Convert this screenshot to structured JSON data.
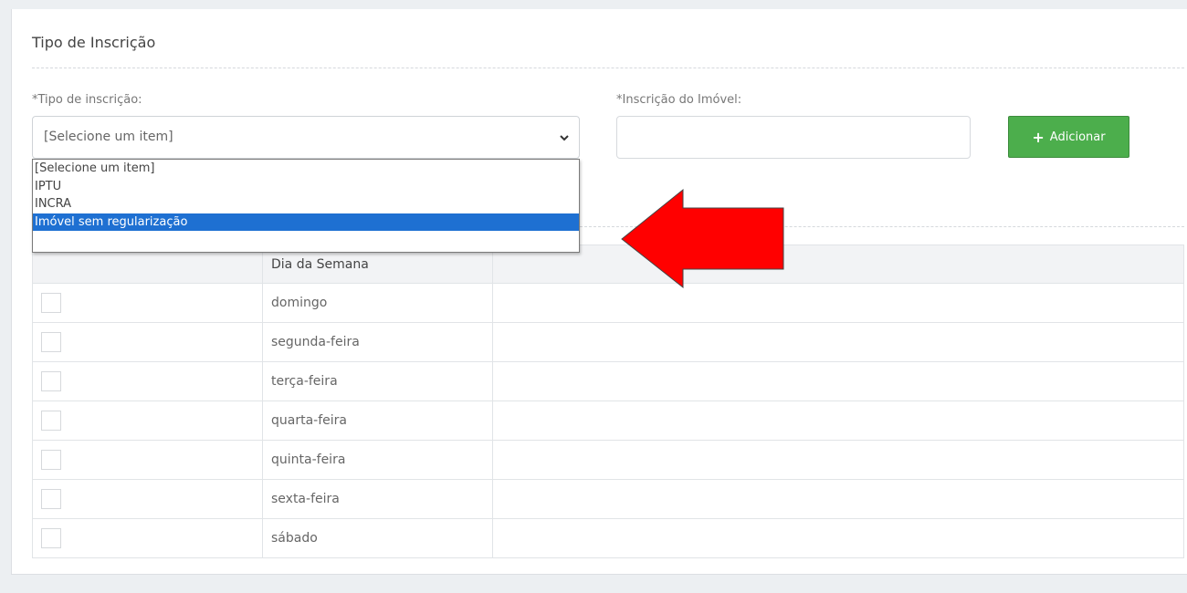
{
  "section": {
    "title": "Tipo de Inscrição"
  },
  "fields": {
    "tipo_label": "*Tipo de inscrição:",
    "tipo_selected": "[Selecione um item]",
    "imovel_label": "*Inscrição do Imóvel:",
    "imovel_value": ""
  },
  "add_button": {
    "icon": "plus-icon",
    "label": "Adicionar",
    "color": "#4cae4c"
  },
  "dropdown": {
    "options": [
      "[Selecione um item]",
      "IPTU",
      "INCRA",
      "Imóvel sem regularização"
    ],
    "highlighted": "Imóvel sem regularização",
    "highlight_color": "#1e70d2"
  },
  "annotation": {
    "icon": "red-arrow-icon",
    "color": "#ff0000"
  },
  "table": {
    "headers": [
      "",
      "Dia da Semana",
      ""
    ],
    "rows": [
      "domingo",
      "segunda-feira",
      "terça-feira",
      "quarta-feira",
      "quinta-feira",
      "sexta-feira",
      "sábado"
    ]
  }
}
